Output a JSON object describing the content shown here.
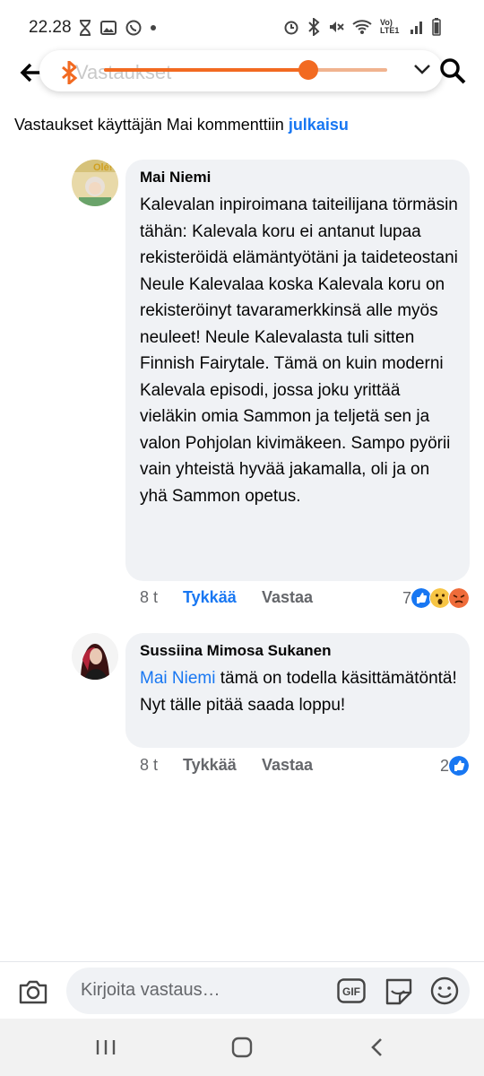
{
  "status_bar": {
    "time": "22.28",
    "lte_label": "Vo) LTE1"
  },
  "top_bar": {
    "search_placeholder": "Vastaukset"
  },
  "header": {
    "prefix": "Vastaukset käyttäjän Mai kommenttiin ",
    "link": "julkaisu"
  },
  "comments": [
    {
      "author": "Mai Niemi",
      "text": "Kalevalan inpiroimana taiteilijana törmäsin tähän: Kalevala koru ei antanut lupaa rekisteröidä elämäntyötäni ja taideteostani Neule Kalevalaa koska Kalevala koru on rekisteröinyt tavaramerkkinsä alle myös neuleet! Neule Kalevalasta tuli sitten Finnish Fairytale. Tämä on kuin moderni Kalevala episodi, jossa joku yrittää vieläkin omia Sammon ja teljetä sen ja valon Pohjolan kivimäkeen. Sampo pyörii vain yhteistä hyvää jakamalla, oli ja on yhä Sammon opetus.",
      "time": "8 t",
      "like_label": "Tykkää",
      "reply_label": "Vastaa",
      "reaction_count": "7",
      "liked": true
    },
    {
      "author": "Sussiina Mimosa Sukanen",
      "mention": "Mai Niemi",
      "text": " tämä on todella käsittämätöntä! Nyt tälle pitää saada loppu!",
      "time": "8 t",
      "like_label": "Tykkää",
      "reply_label": "Vastaa",
      "reaction_count": "2",
      "liked": false
    }
  ],
  "composer": {
    "placeholder": "Kirjoita vastaus…",
    "gif_label": "GIF"
  },
  "colors": {
    "link_blue": "#1877f2",
    "bubble_gray": "#f0f2f5",
    "slider_orange": "#f26a21"
  },
  "icons": [
    "back-arrow-icon",
    "bluetooth-icon",
    "chevron-down-icon",
    "search-icon",
    "camera-icon",
    "gif-icon",
    "sticker-icon",
    "emoji-icon",
    "like-reaction-icon",
    "wow-reaction-icon",
    "angry-reaction-icon"
  ]
}
